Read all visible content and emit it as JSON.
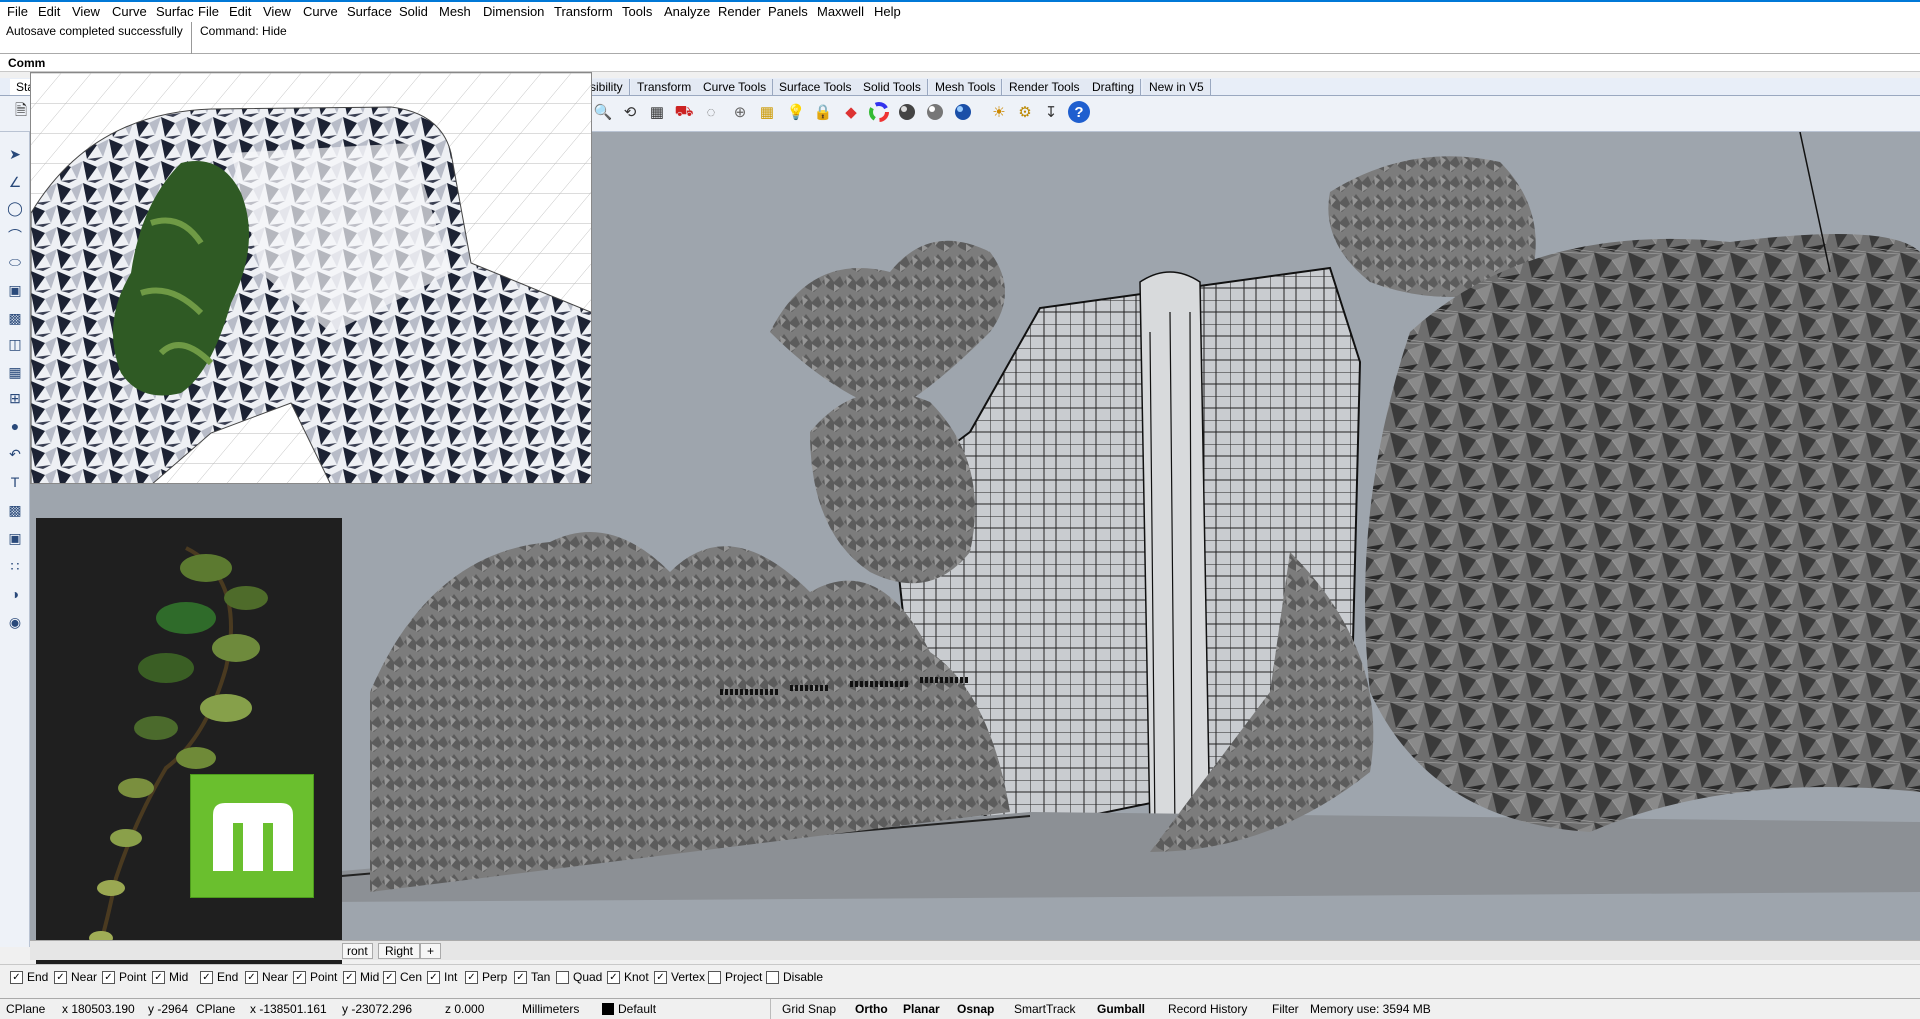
{
  "menu_left": [
    "File",
    "Edit",
    "View",
    "Curve",
    "Surfac"
  ],
  "menu_main": [
    "File",
    "Edit",
    "View",
    "Curve",
    "Surface",
    "Solid",
    "Mesh",
    "Dimension",
    "Transform",
    "Tools",
    "Analyze",
    "Render",
    "Panels",
    "Maxwell",
    "Help"
  ],
  "command_history": {
    "left": "Autosave completed successfully",
    "right": "Command: Hide"
  },
  "command_prompt": "Comm",
  "tabs": [
    "Star",
    "sibility",
    "Transform",
    "Curve Tools",
    "Surface Tools",
    "Solid Tools",
    "Mesh Tools",
    "Render Tools",
    "Drafting",
    "New in V5"
  ],
  "viewport_tabs": [
    "ront",
    "Right",
    "+"
  ],
  "osnap_left": [
    {
      "label": "End",
      "checked": true
    },
    {
      "label": "Near",
      "checked": true
    },
    {
      "label": "Point",
      "checked": true
    },
    {
      "label": "Mid",
      "checked": true
    }
  ],
  "osnap_main": [
    {
      "label": "End",
      "checked": true
    },
    {
      "label": "Near",
      "checked": true
    },
    {
      "label": "Point",
      "checked": true
    },
    {
      "label": "Mid",
      "checked": true
    },
    {
      "label": "Cen",
      "checked": true
    },
    {
      "label": "Int",
      "checked": true
    },
    {
      "label": "Perp",
      "checked": true
    },
    {
      "label": "Tan",
      "checked": true
    },
    {
      "label": "Quad",
      "checked": false
    },
    {
      "label": "Knot",
      "checked": true
    },
    {
      "label": "Vertex",
      "checked": true
    },
    {
      "label": "Project",
      "checked": false
    },
    {
      "label": "Disable",
      "checked": false
    }
  ],
  "status": {
    "cplane_left": "CPlane",
    "x_left": "x 180503.190",
    "y_left": "y -2964",
    "cplane": "CPlane",
    "x": "x -138501.161",
    "y": "y -23072.296",
    "z": "z 0.000",
    "units": "Millimeters",
    "layer": "Default",
    "grid_snap": "Grid Snap",
    "ortho": "Ortho",
    "planar": "Planar",
    "osnap": "Osnap",
    "smarttrack": "SmartTrack",
    "gumball": "Gumball",
    "record_history": "Record History",
    "filter": "Filter",
    "memory": "Memory use: 3594 MB"
  },
  "colors": {
    "viewport_bg": "#9ea5ad",
    "accent": "#0078d7",
    "brand_green": "#6abf2e"
  }
}
